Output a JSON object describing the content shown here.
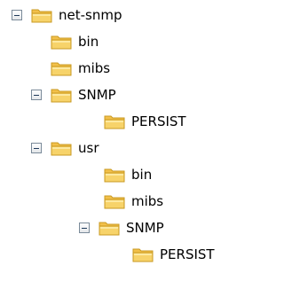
{
  "tree": {
    "nodes": [
      {
        "label": "net-snmp",
        "expanded": true,
        "icon": "folder-icon",
        "toggle_icon": "minus-icon"
      },
      {
        "label": "bin",
        "icon": "folder-icon"
      },
      {
        "label": "mibs",
        "icon": "folder-icon"
      },
      {
        "label": "SNMP",
        "expanded": true,
        "icon": "folder-icon",
        "toggle_icon": "minus-icon"
      },
      {
        "label": "PERSIST",
        "icon": "folder-icon"
      },
      {
        "label": "usr",
        "expanded": true,
        "icon": "folder-icon",
        "toggle_icon": "minus-icon"
      },
      {
        "label": "bin",
        "icon": "folder-icon"
      },
      {
        "label": "mibs",
        "icon": "folder-icon"
      },
      {
        "label": "SNMP",
        "expanded": true,
        "icon": "folder-icon",
        "toggle_icon": "minus-icon"
      },
      {
        "label": "PERSIST",
        "icon": "folder-icon"
      }
    ]
  },
  "colors": {
    "folder_fill": "#f7d36a",
    "folder_light": "#fde9a0",
    "folder_stroke": "#c99a22",
    "toggle_border": "#7a8a99"
  }
}
